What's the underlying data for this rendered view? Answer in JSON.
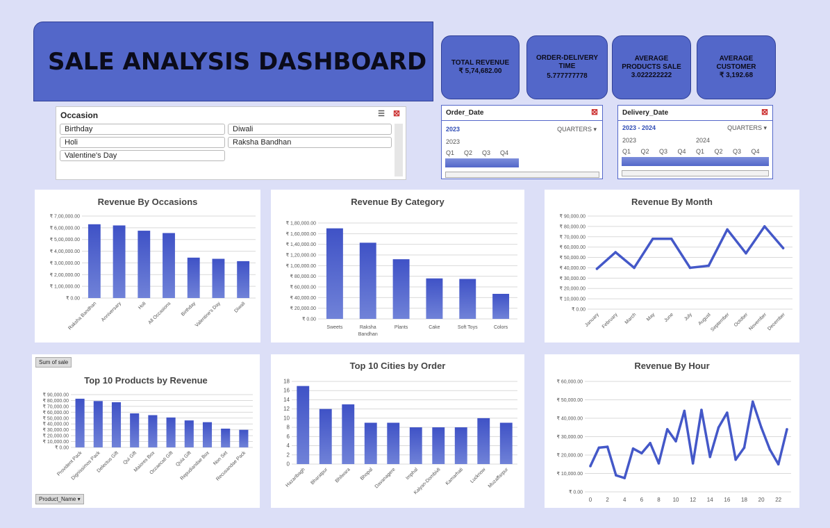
{
  "header": {
    "title": "SALE ANALYSIS DASHBOARD"
  },
  "kpis": [
    {
      "label": "TOTAL REVENUE",
      "value": "₹ 5,74,682.00"
    },
    {
      "label": "ORDER-DELIVERY\nTIME",
      "value": "5.777777778"
    },
    {
      "label": "AVERAGE\nPRODUCTS SALE",
      "value": "3.022222222"
    },
    {
      "label": "AVERAGE\nCUSTOMER",
      "value": "₹ 3,192.68"
    }
  ],
  "occasion_slicer": {
    "title": "Occasion",
    "items": [
      "Birthday",
      "Diwali",
      "Holi",
      "Raksha Bandhan",
      "Valentine's Day"
    ]
  },
  "order_date": {
    "title": "Order_Date",
    "period": "2023",
    "level": "QUARTERS",
    "years": [
      "2023"
    ],
    "quarters": [
      "Q1",
      "Q2",
      "Q3",
      "Q4"
    ]
  },
  "delivery_date": {
    "title": "Delivery_Date",
    "period": "2023 - 2024",
    "level": "QUARTERS",
    "years": [
      "2023",
      "2024"
    ],
    "quarters": [
      "Q1",
      "Q2",
      "Q3",
      "Q4",
      "Q1",
      "Q2",
      "Q3",
      "Q4"
    ]
  },
  "pivot_buttons": {
    "sum_of_sale": "Sum of sale",
    "product_name": "Product_Name"
  },
  "colors": {
    "accent": "#5367c9",
    "bar": "#4458c8",
    "line": "#4458c8"
  },
  "chart_data": [
    {
      "id": "occasions",
      "type": "bar",
      "title": "Revenue By Occasions",
      "categories": [
        "Raksha Bandhan",
        "Anniversary",
        "Holi",
        "All Occasions",
        "Birthday",
        "Valentine's Day",
        "Diwali"
      ],
      "values": [
        630000,
        620000,
        575000,
        555000,
        345000,
        335000,
        315000
      ],
      "ylim": [
        0,
        700000
      ],
      "yticks": [
        "₹ 0.00",
        "₹ 1,00,000.00",
        "₹ 2,00,000.00",
        "₹ 3,00,000.00",
        "₹ 4,00,000.00",
        "₹ 5,00,000.00",
        "₹ 6,00,000.00",
        "₹ 7,00,000.00"
      ]
    },
    {
      "id": "category",
      "type": "bar",
      "title": "Revenue By Category",
      "categories": [
        "Sweets",
        "Raksha Bandhan",
        "Plants",
        "Cake",
        "Soft Toys",
        "Colors"
      ],
      "values": [
        170000,
        143000,
        112000,
        76000,
        75000,
        47000
      ],
      "ylim": [
        0,
        180000
      ],
      "yticks": [
        "₹ 0.00",
        "₹ 20,000.00",
        "₹ 40,000.00",
        "₹ 60,000.00",
        "₹ 80,000.00",
        "₹ 1,00,000.00",
        "₹ 1,20,000.00",
        "₹ 1,40,000.00",
        "₹ 1,60,000.00",
        "₹ 1,80,000.00"
      ]
    },
    {
      "id": "month",
      "type": "line",
      "title": "Revenue By Month",
      "categories": [
        "January",
        "February",
        "March",
        "May",
        "June",
        "July",
        "August",
        "September",
        "October",
        "November",
        "December"
      ],
      "values": [
        39000,
        55000,
        40000,
        68000,
        68000,
        40000,
        42000,
        77000,
        54000,
        80000,
        59000
      ],
      "ylim": [
        0,
        90000
      ],
      "yticks": [
        "₹ 0.00",
        "₹ 10,000.00",
        "₹ 20,000.00",
        "₹ 30,000.00",
        "₹ 40,000.00",
        "₹ 50,000.00",
        "₹ 60,000.00",
        "₹ 70,000.00",
        "₹ 80,000.00",
        "₹ 90,000.00"
      ]
    },
    {
      "id": "products",
      "type": "bar",
      "title": "Top 10 Products by Revenue",
      "categories": [
        "Provident Pack",
        "Dignissimos Pack",
        "Delectus Gift",
        "Qui Gift",
        "Maiores Box",
        "Occaecati Gift",
        "Quia Gift",
        "Repudiandae Box",
        "Non Set",
        "Recusandae Pack"
      ],
      "values": [
        83000,
        79000,
        77000,
        58000,
        55000,
        51000,
        46000,
        43000,
        32000,
        30000
      ],
      "ylim": [
        0,
        90000
      ],
      "yticks": [
        "₹ 0.00",
        "₹ 10,000.00",
        "₹ 20,000.00",
        "₹ 30,000.00",
        "₹ 40,000.00",
        "₹ 50,000.00",
        "₹ 60,000.00",
        "₹ 70,000.00",
        "₹ 80,000.00",
        "₹ 90,000.00"
      ]
    },
    {
      "id": "cities",
      "type": "bar",
      "title": "Top 10 Cities by Order",
      "categories": [
        "Hazaribagh",
        "Bharatpur",
        "Bhilwara",
        "Bhopal",
        "Davanagere",
        "Imphal",
        "Kalyan-Dombivli",
        "Kamarhati",
        "Lucknow",
        "Muzaffarpur"
      ],
      "values": [
        17,
        12,
        13,
        9,
        9,
        8,
        8,
        8,
        10,
        9
      ],
      "ylim": [
        0,
        18
      ],
      "yticks": [
        "0",
        "2",
        "4",
        "6",
        "8",
        "10",
        "12",
        "14",
        "16",
        "18"
      ]
    },
    {
      "id": "hour",
      "type": "line",
      "title": "Revenue By Hour",
      "x": [
        0,
        1,
        2,
        3,
        4,
        5,
        6,
        7,
        8,
        9,
        10,
        11,
        12,
        13,
        14,
        15,
        16,
        17,
        18,
        19,
        20,
        21,
        22,
        23
      ],
      "xticks": [
        "0",
        "2",
        "4",
        "6",
        "8",
        "10",
        "12",
        "14",
        "16",
        "18",
        "20",
        "22"
      ],
      "values": [
        14000,
        24000,
        24500,
        9000,
        7500,
        23500,
        21000,
        26500,
        15500,
        34000,
        27500,
        44000,
        15500,
        44500,
        19000,
        35000,
        43000,
        17500,
        24000,
        49000,
        35000,
        23000,
        15000,
        34000
      ],
      "ylim": [
        0,
        60000
      ],
      "yticks": [
        "₹ 0.00",
        "₹ 10,000.00",
        "₹ 20,000.00",
        "₹ 30,000.00",
        "₹ 40,000.00",
        "₹ 50,000.00",
        "₹ 60,000.00"
      ]
    }
  ]
}
